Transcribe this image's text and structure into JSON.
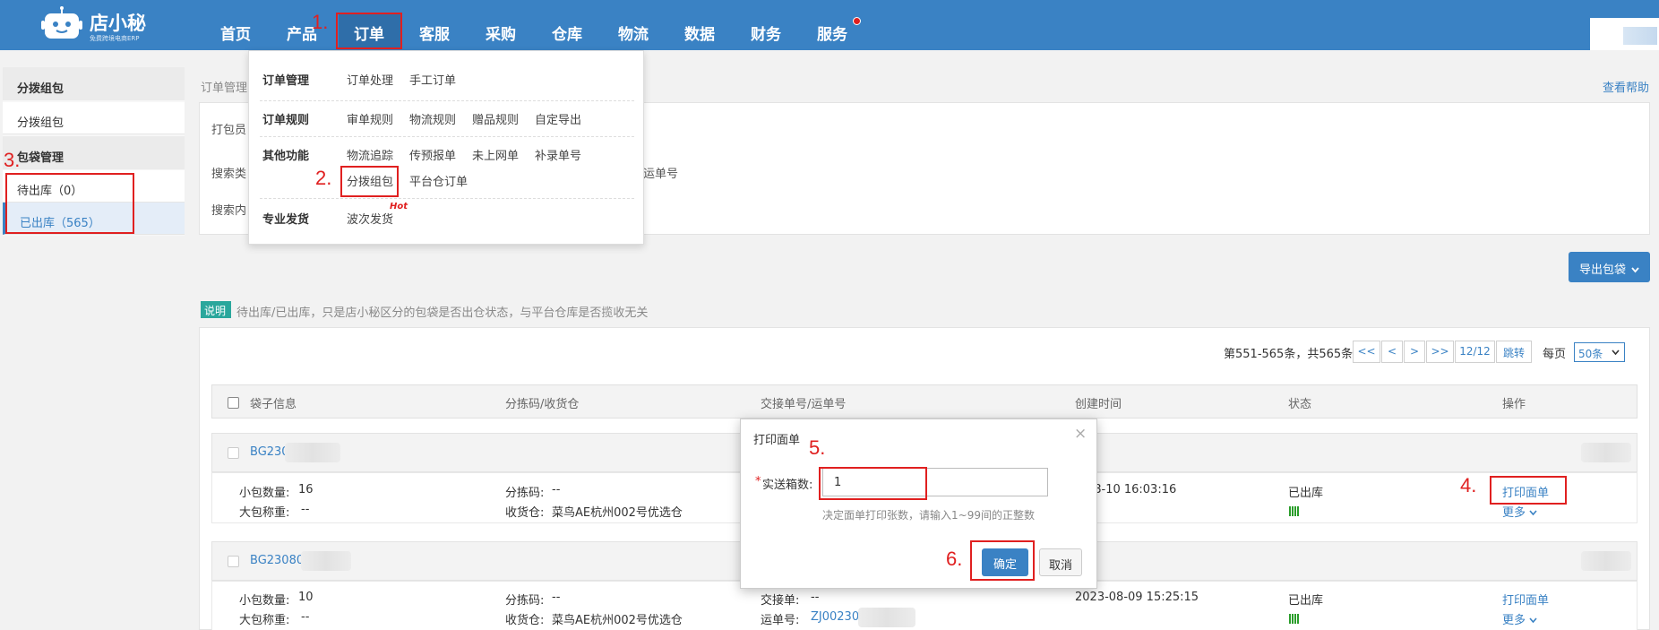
{
  "app": {
    "brand": "店小秘",
    "brand_sub": "免费跨境电商ERP"
  },
  "nav": [
    "首页",
    "产品",
    "订单",
    "客服",
    "采购",
    "仓库",
    "物流",
    "数据",
    "财务",
    "服务"
  ],
  "menu": {
    "rows": [
      {
        "head": "订单管理",
        "links": [
          "订单处理",
          "手工订单"
        ]
      },
      {
        "head": "订单规则",
        "links": [
          "审单规则",
          "物流规则",
          "赠品规则",
          "自定导出"
        ]
      },
      {
        "head": "其他功能",
        "links": [
          "物流追踪",
          "传预报单",
          "未上网单",
          "补录单号",
          "分拨组包",
          "平台仓订单"
        ]
      },
      {
        "head": "专业发货",
        "links": [
          "波次发货"
        ]
      }
    ],
    "hot": "Hot"
  },
  "sidebar": {
    "section1": "分拨组包",
    "item1": "分拨组包",
    "section2": "包袋管理",
    "pending": "待出库（0）",
    "shipped": "已出库（565）"
  },
  "page": {
    "breadcrumb": "订单管理",
    "help": "查看帮助",
    "label_packer": "打包员",
    "label_search_type": "搜索类",
    "label_search_content": "搜索内",
    "waybill_option": "运单号",
    "export_button": "导出包袋",
    "note_tag": "说明",
    "note_text": "待出库/已出库，只是店小秘区分的包袋是否出仓状态，与平台仓库是否揽收无关"
  },
  "pager": {
    "info": "第551-565条，共565条",
    "first": "<<",
    "prev": "<",
    "next": ">",
    "last": ">>",
    "page": "12/12",
    "jump": "跳转",
    "per_page_label": "每页",
    "per_page_value": "50条"
  },
  "table": {
    "headers": [
      "袋子信息",
      "分拣码/收货仓",
      "交接单号/运单号",
      "创建时间",
      "状态",
      "操作"
    ],
    "rows": [
      {
        "bag_no": "BG2308",
        "small_count_label": "小包数量:",
        "small_count": "16",
        "big_weight_label": "大包称重:",
        "big_weight": "--",
        "sort_code_label": "分拣码:",
        "sort_code": "--",
        "warehouse_label": "收货仓:",
        "warehouse": "菜鸟AE杭州002号优选仓",
        "created": "2023-08-10 16:03:16",
        "created_visible": "3-08-10 16:03:16",
        "status": "已出库",
        "action_print": "打印面单",
        "action_more": "更多"
      },
      {
        "bag_no": "BG23080",
        "small_count_label": "小包数量:",
        "small_count": "10",
        "big_weight_label": "大包称重:",
        "big_weight": "--",
        "sort_code_label": "分拣码:",
        "sort_code": "--",
        "warehouse_label": "收货仓:",
        "warehouse": "菜鸟AE杭州002号优选仓",
        "handover_label": "交接单:",
        "handover": "--",
        "waybill_label": "运单号:",
        "waybill": "ZJ00230",
        "created": "2023-08-09 15:25:15",
        "status": "已出库",
        "action_print": "打印面单",
        "action_more": "更多"
      }
    ]
  },
  "modal": {
    "title": "打印面单",
    "close": "×",
    "required_mark": "*",
    "field_label": "实送箱数:",
    "field_value": "1",
    "hint": "决定面单打印张数，请输入1~99间的正整数",
    "ok": "确定",
    "cancel": "取消"
  },
  "annotations": [
    "1.",
    "2.",
    "3.",
    "4.",
    "5.",
    "6."
  ],
  "colors": {
    "primary": "#3a82c4",
    "annotation": "#e02020",
    "note_tag": "#2aa79c"
  }
}
